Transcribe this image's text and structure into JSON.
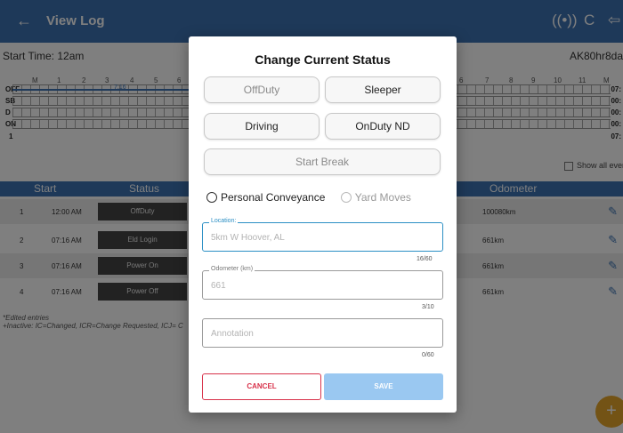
{
  "appbar": {
    "title": "View Log",
    "back_icon": "arrow-left-icon",
    "eld_icon": "eld-connection-icon",
    "refresh_icon": "refresh-icon",
    "logout_icon": "logout-icon"
  },
  "log": {
    "start_time": "Start Time: 12am",
    "log_id": "AK80hr8da",
    "rows": [
      "OFF",
      "SB",
      "D",
      "ON"
    ],
    "hours": [
      "M",
      "1",
      "2",
      "3",
      "4",
      "5",
      "6",
      "7",
      "8",
      "9",
      "10",
      "11",
      "M"
    ],
    "time_marker": "7:16",
    "totals": [
      "07:",
      "00:",
      "00:",
      "00:",
      "07:"
    ],
    "row_number": "1",
    "show_all_label": "Show all even"
  },
  "table": {
    "headers": {
      "start": "Start",
      "status": "Status",
      "odometer": "Odometer"
    },
    "rows": [
      {
        "num": "1",
        "time": "12:00 AM",
        "status": "OffDuty",
        "odometer": "100080km"
      },
      {
        "num": "2",
        "time": "07:16 AM",
        "status": "Eld Login",
        "odometer": "661km"
      },
      {
        "num": "3",
        "time": "07:16 AM",
        "status": "Power On",
        "odometer": "661km"
      },
      {
        "num": "4",
        "time": "07:16 AM",
        "status": "Power Off",
        "odometer": "661km"
      }
    ],
    "footnote1": "*Edited entries",
    "footnote2": "+Inactive: IC=Changed, ICR=Change Requested, ICJ= C"
  },
  "fab_icon": "+",
  "dialog": {
    "title": "Change Current Status",
    "buttons": {
      "offduty": "OffDuty",
      "sleeper": "Sleeper",
      "driving": "Driving",
      "onduty_nd": "OnDuty ND",
      "start_break": "Start Break"
    },
    "personal_conveyance": "Personal Conveyance",
    "yard_moves": "Yard Moves",
    "location": {
      "label": "Location:",
      "placeholder": "5km W Hoover, AL",
      "counter": "16/60"
    },
    "odometer": {
      "label": "Odometer (km)",
      "placeholder": "661",
      "counter": "3/10"
    },
    "annotation": {
      "placeholder": "Annotation",
      "counter": "0/60"
    },
    "cancel": "CANCEL",
    "save": "SAVE"
  }
}
